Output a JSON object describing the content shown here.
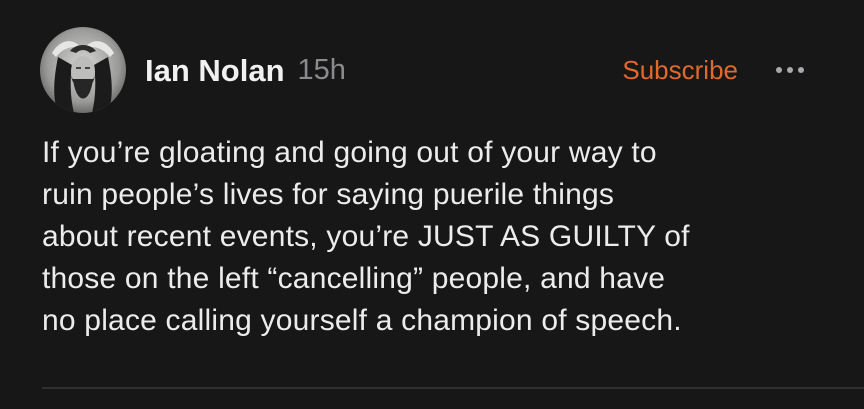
{
  "post": {
    "author": "Ian Nolan",
    "time": "15h",
    "subscribe_label": "Subscribe",
    "more_icon": "more-horizontal-icon",
    "lines": [
      "If you’re gloating and going out of your way to",
      "ruin people’s lives for saying puerile things",
      "about recent events, you’re JUST AS GUILTY of",
      "those on the left “cancelling” people, and have",
      "no place calling yourself a champion of speech."
    ]
  },
  "colors": {
    "background": "#171718",
    "text": "#ececec",
    "muted": "#8b8b8e",
    "accent": "#e2692b"
  }
}
